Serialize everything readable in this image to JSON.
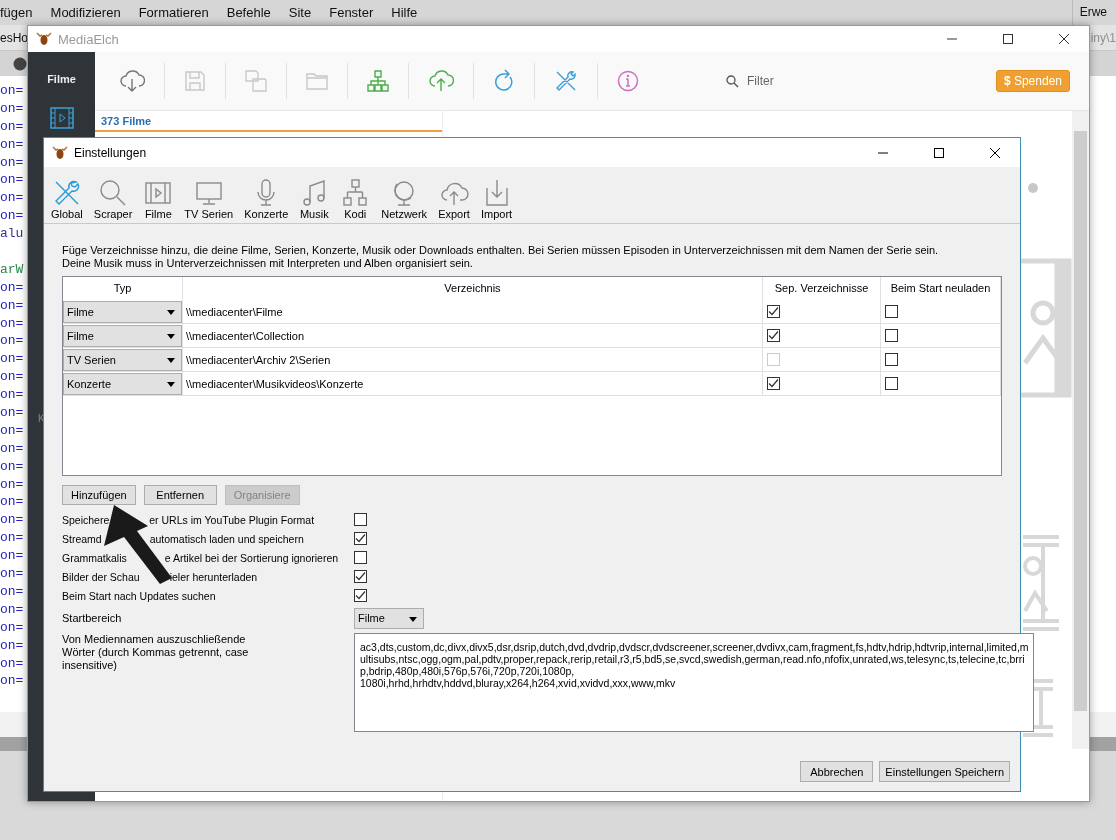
{
  "background_app": {
    "menu": [
      "fügen",
      "Modifizieren",
      "Formatieren",
      "Befehle",
      "Site",
      "Fenster",
      "Hilfe"
    ],
    "menu_right": "Erwe",
    "tab": "esHo",
    "path": "iny\\1",
    "code_lines": [
      {
        "text": "on=",
        "kind": "attr"
      },
      {
        "text": "on=",
        "kind": "attr"
      },
      {
        "text": "on=",
        "kind": "attr"
      },
      {
        "text": "on=",
        "kind": "attr"
      },
      {
        "text": "on=",
        "kind": "attr"
      },
      {
        "text": "on=",
        "kind": "attr"
      },
      {
        "text": "on=",
        "kind": "attr"
      },
      {
        "text": "on=",
        "kind": "attr"
      },
      {
        "text": "alu",
        "kind": "value"
      },
      {
        "kind": "blank"
      },
      {
        "text": "arW",
        "kind": "var"
      },
      {
        "text": "on=",
        "kind": "attr"
      },
      {
        "text": "on=",
        "kind": "attr"
      },
      {
        "text": "on=",
        "kind": "attr"
      },
      {
        "text": "on=",
        "kind": "attr"
      },
      {
        "text": "on=",
        "kind": "attr"
      },
      {
        "text": "on=",
        "kind": "attr"
      },
      {
        "text": "on=",
        "kind": "attr"
      },
      {
        "text": "on=",
        "kind": "attr"
      },
      {
        "text": "on=",
        "kind": "attr"
      },
      {
        "text": "on=",
        "kind": "attr"
      },
      {
        "text": "on=",
        "kind": "attr"
      },
      {
        "text": "on=",
        "kind": "attr"
      },
      {
        "text": "on=",
        "kind": "attr"
      },
      {
        "text": "on=",
        "kind": "attr"
      },
      {
        "text": "on=",
        "kind": "attr"
      },
      {
        "text": "on=",
        "kind": "attr"
      },
      {
        "text": "on=",
        "kind": "attr"
      },
      {
        "text": "on=",
        "kind": "attr"
      },
      {
        "text": "on=",
        "kind": "attr"
      },
      {
        "text": "on=",
        "kind": "attr"
      },
      {
        "text": "on=",
        "kind": "attr"
      },
      {
        "text": "on=",
        "kind": "attr"
      },
      {
        "text": "on=",
        "kind": "attr"
      }
    ]
  },
  "mediaelch": {
    "title": "MediaElch",
    "sidebar_section": "Filme",
    "sidebar_partial": "K",
    "filter": {
      "placeholder": "Filter"
    },
    "donate": {
      "symbol": "$",
      "label": "Spenden"
    },
    "list_header": "373 Filme"
  },
  "settings": {
    "title": "Einstellungen",
    "tabs": [
      {
        "label": "Global",
        "selected": true
      },
      {
        "label": "Scraper",
        "selected": false
      },
      {
        "label": "Filme",
        "selected": false
      },
      {
        "label": "TV Serien",
        "selected": false
      },
      {
        "label": "Konzerte",
        "selected": false
      },
      {
        "label": "Musik",
        "selected": false
      },
      {
        "label": "Kodi",
        "selected": false
      },
      {
        "label": "Netzwerk",
        "selected": false
      },
      {
        "label": "Export",
        "selected": false
      },
      {
        "label": "Import",
        "selected": false
      }
    ],
    "intro": [
      "Füge Verzeichnisse hinzu, die deine Filme, Serien, Konzerte, Musik oder Downloads enthalten. Bei Serien müssen Episoden in Unterverzeichnissen mit dem Namen der Serie sein.",
      "Deine Musik muss in Unterverzeichnissen mit Interpreten und Alben organisiert sein."
    ],
    "table": {
      "columns": [
        "Typ",
        "Verzeichnis",
        "Sep. Verzeichnisse",
        "Beim Start neuladen"
      ],
      "rows": [
        {
          "type": "Filme",
          "path": "\\\\mediacenter\\Filme",
          "separate": {
            "checked": true,
            "disabled": false
          },
          "reload": {
            "checked": false
          }
        },
        {
          "type": "Filme",
          "path": "\\\\mediacenter\\Collection",
          "separate": {
            "checked": true,
            "disabled": false
          },
          "reload": {
            "checked": false
          }
        },
        {
          "type": "TV Serien",
          "path": "\\\\mediacenter\\Archiv 2\\Serien",
          "separate": {
            "checked": false,
            "disabled": true
          },
          "reload": {
            "checked": false
          }
        },
        {
          "type": "Konzerte",
          "path": "\\\\mediacenter\\Musikvideos\\Konzerte",
          "separate": {
            "checked": true,
            "disabled": false
          },
          "reload": {
            "checked": false
          }
        }
      ]
    },
    "buttons": [
      {
        "label": "Hinzufügen",
        "disabled": false
      },
      {
        "label": "Entfernen",
        "disabled": false
      },
      {
        "label": "Organisiere",
        "disabled": true
      }
    ],
    "options": [
      {
        "label_parts": [
          "Speichere",
          "er URLs im YouTube Plugin Format"
        ],
        "checked": false
      },
      {
        "label_parts": [
          "Streamd",
          "automatisch laden und speichern"
        ],
        "checked": true
      },
      {
        "label_parts": [
          "Grammatkalis",
          "e Artikel bei der Sortierung ignorieren"
        ],
        "checked": false
      },
      {
        "label_parts": [
          "Bilder der Schau",
          "ieler herunterladen"
        ],
        "checked": true
      },
      {
        "label_parts": [
          "Beim Start nach Updates suchen"
        ],
        "checked": true
      }
    ],
    "start_area": {
      "label": "Startbereich",
      "value": "Filme"
    },
    "exclude": {
      "label": "Von Mediennamen auszuschließende Wörter (durch Kommas getrennt, case insensitive)",
      "value": "ac3,dts,custom,dc,divx,divx5,dsr,dsrip,dutch,dvd,dvdrip,dvdscr,dvdscreener,screener,dvdivx,cam,fragment,fs,hdtv,hdrip,hdtvrip,internal,limited,multisubs,ntsc,ogg,ogm,pal,pdtv,proper,repack,rerip,retail,r3,r5,bd5,se,svcd,swedish,german,read.nfo,nfofix,unrated,ws,telesync,ts,telecine,tc,brrip,bdrip,480p,480i,576p,576i,720p,720i,1080p,\n1080i,hrhd,hrhdtv,hddvd,bluray,x264,h264,xvid,xvidvd,xxx,www,mkv"
    },
    "footer_buttons": [
      "Abbrechen",
      "Einstellungen Speichern"
    ]
  }
}
